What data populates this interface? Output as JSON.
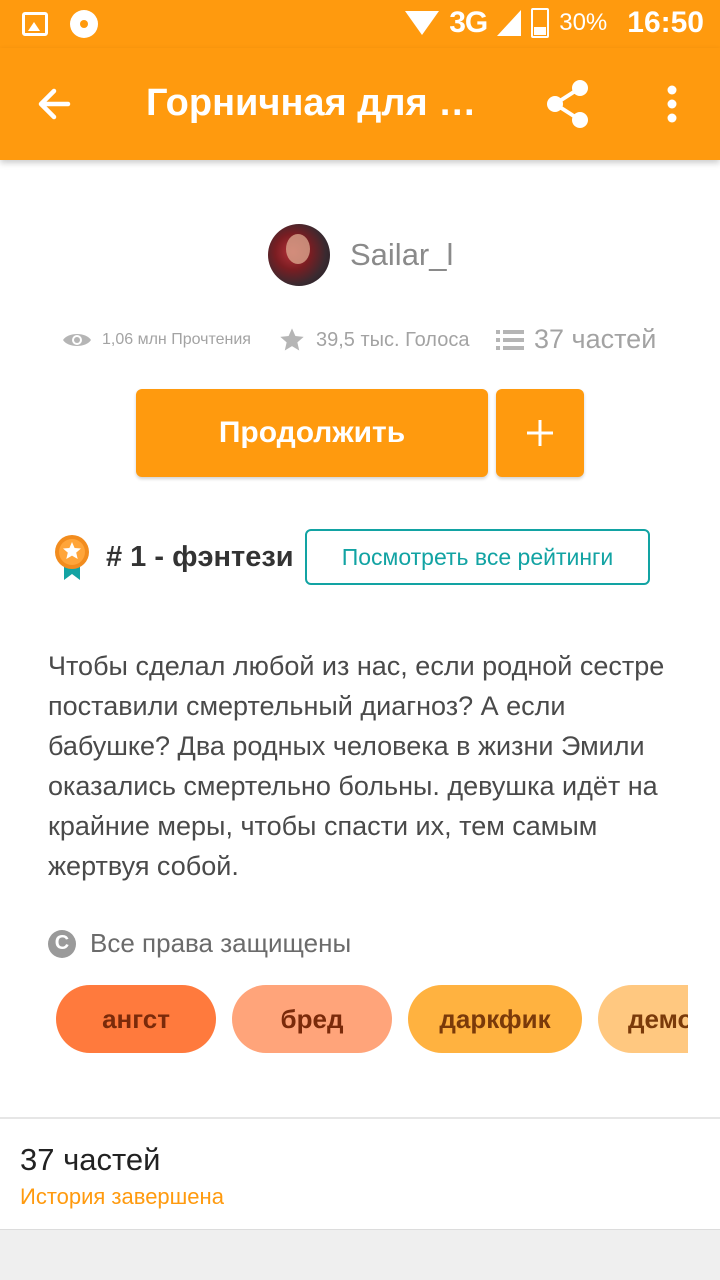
{
  "status_bar": {
    "network": "3G",
    "battery": "30%",
    "time": "16:50"
  },
  "app_bar": {
    "title": "Горничная для С..."
  },
  "story": {
    "author": "Sailar_l",
    "reads": "1,06 млн Прочтения",
    "votes": "39,5 тыс. Голоса",
    "parts": "37 частей",
    "continue_label": "Продолжить",
    "rank": "# 1 - фэнтези",
    "ratings_label": "Посмотреть все рейтинги",
    "description": "Чтобы сделал любой из нас, если родной сестре поставили смертельный диагноз? А если бабушке? Два родных человека в жизни Эмили оказались смертельно больны. девушка идёт на крайние меры, чтобы спасти их, тем самым жертвуя собой.",
    "copyright": "Все права защищены",
    "tags": [
      "ангст",
      "бред",
      "даркфик",
      "демо"
    ]
  },
  "parts_section": {
    "title": "37 частей",
    "status": "История завершена"
  },
  "colors": {
    "accent": "#ff9a0e",
    "teal": "#12a3a3"
  },
  "icons": [
    "back-arrow-icon",
    "share-icon",
    "more-vertical-icon",
    "eye-icon",
    "star-icon",
    "list-icon",
    "plus-icon",
    "medal-icon",
    "copyright-icon"
  ]
}
